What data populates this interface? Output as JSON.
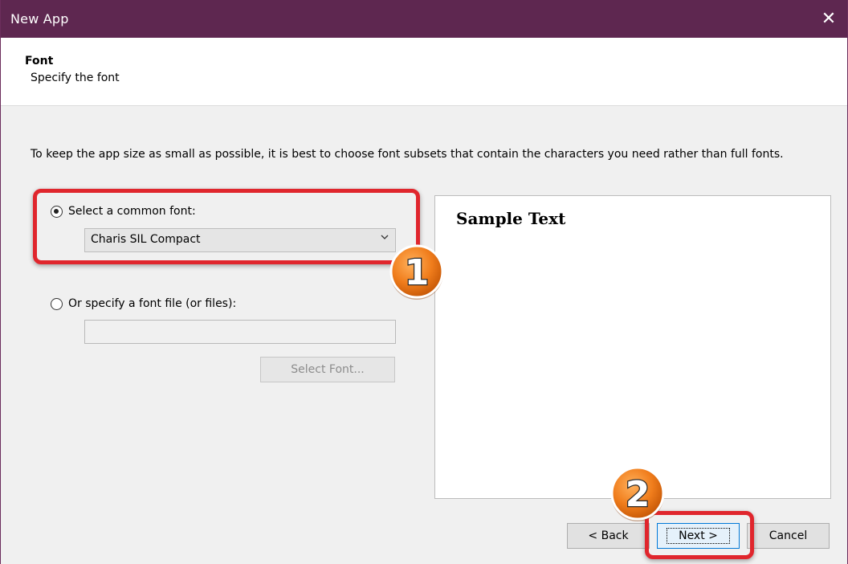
{
  "window": {
    "title": "New App",
    "close_glyph": "✕"
  },
  "header": {
    "title": "Font",
    "subtitle": "Specify the font"
  },
  "intro": "To keep the app size as small as possible, it is best to choose font subsets that contain the characters you need rather than full fonts.",
  "options": {
    "common_label": "Select a common font:",
    "common_selected": true,
    "common_value": "Charis SIL Compact",
    "file_label": "Or specify a font file (or files):",
    "file_selected": false,
    "file_value": "",
    "select_font_button": "Select Font..."
  },
  "preview": {
    "sample_text": "Sample Text"
  },
  "buttons": {
    "back": "< Back",
    "next": "Next >",
    "cancel": "Cancel"
  },
  "annotations": {
    "badge1": "1",
    "badge2": "2"
  },
  "colors": {
    "titlebar": "#5e2750",
    "highlight": "#e0262d",
    "badge": "#f58220"
  }
}
